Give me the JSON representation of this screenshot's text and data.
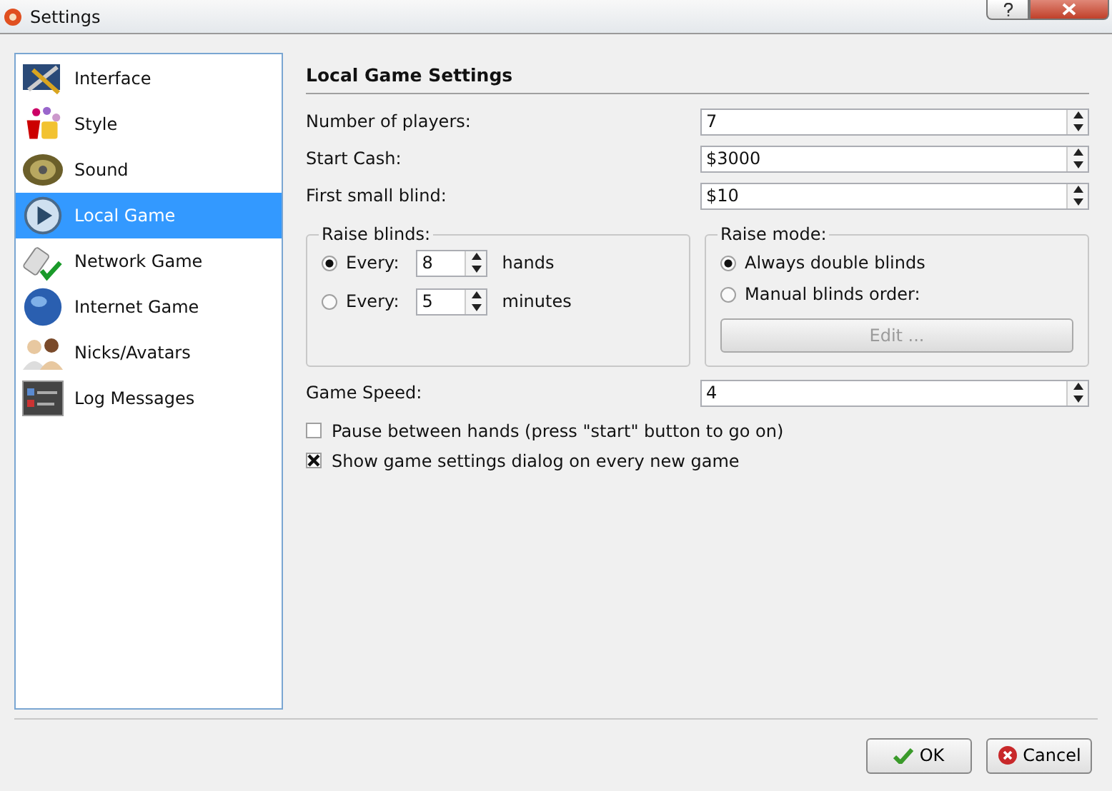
{
  "window": {
    "title": "Settings"
  },
  "sidebar": {
    "items": [
      {
        "label": "Interface",
        "kind": "interface",
        "selected": false
      },
      {
        "label": "Style",
        "kind": "style",
        "selected": false
      },
      {
        "label": "Sound",
        "kind": "sound",
        "selected": false
      },
      {
        "label": "Local Game",
        "kind": "local",
        "selected": true
      },
      {
        "label": "Network Game",
        "kind": "network",
        "selected": false
      },
      {
        "label": "Internet Game",
        "kind": "internet",
        "selected": false
      },
      {
        "label": "Nicks/Avatars",
        "kind": "nicks",
        "selected": false
      },
      {
        "label": "Log Messages",
        "kind": "log",
        "selected": false
      }
    ]
  },
  "section_title": "Local Game Settings",
  "fields": [
    {
      "label": "Number of players:",
      "value": "7"
    },
    {
      "label": "Start Cash:",
      "value": "$3000"
    },
    {
      "label": "First small blind:",
      "value": "$10"
    }
  ],
  "raise_blinds": {
    "title": "Raise blinds:",
    "options": [
      {
        "label": "Every:",
        "value": "8",
        "unit": "hands",
        "selected": true
      },
      {
        "label": "Every:",
        "value": "5",
        "unit": "minutes",
        "selected": false
      }
    ]
  },
  "raise_mode": {
    "title": "Raise mode:",
    "options": [
      {
        "label": "Always double blinds",
        "selected": true
      },
      {
        "label": "Manual blinds order:",
        "selected": false
      }
    ],
    "edit_button": {
      "label": "Edit ...",
      "disabled": true
    }
  },
  "game_speed": {
    "label": "Game Speed:",
    "value": "4"
  },
  "checkboxes": [
    {
      "label": "Pause between hands (press \"start\" button to go on)",
      "checked": false
    },
    {
      "label": "Show game settings dialog on every new game",
      "checked": true
    }
  ],
  "buttons": [
    {
      "label": "OK",
      "kind": "ok"
    },
    {
      "label": "Cancel",
      "kind": "cancel"
    }
  ]
}
